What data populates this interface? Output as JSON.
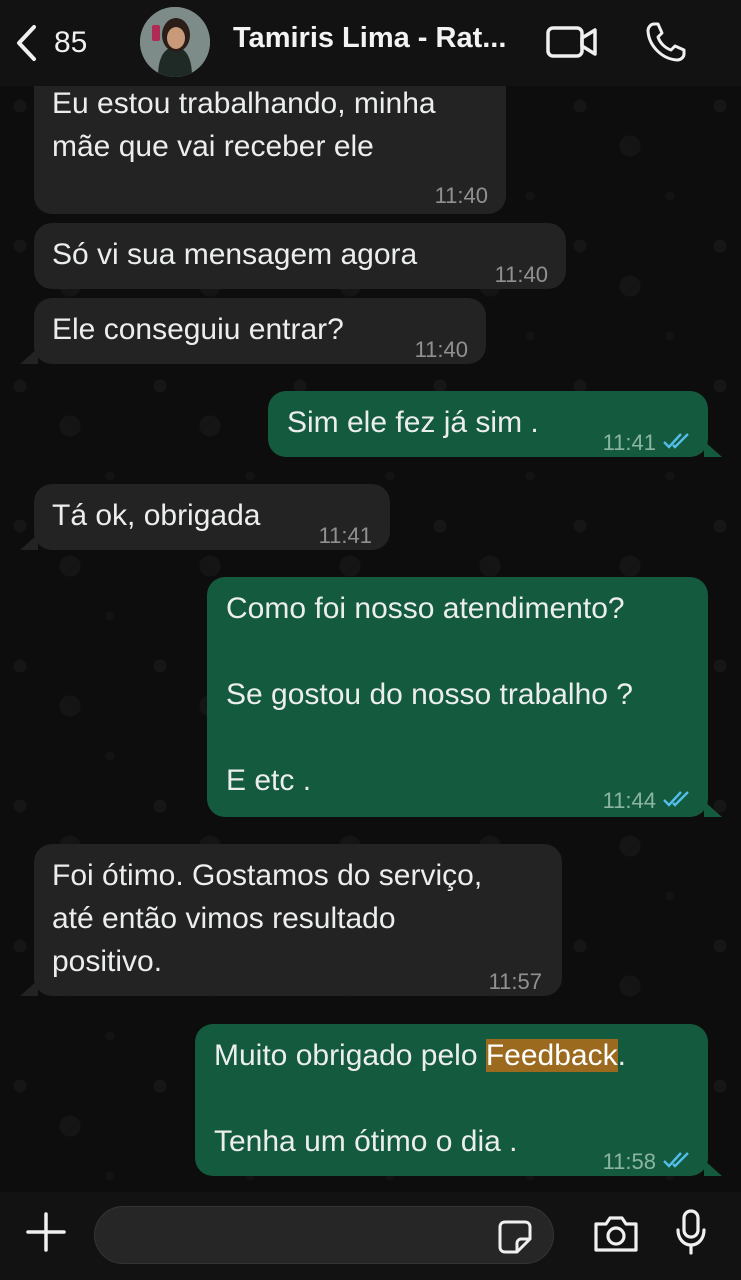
{
  "header": {
    "back_count": "85",
    "contact_name": "Tamiris Lima - Rat..."
  },
  "messages": [
    {
      "dir": "in",
      "text": "Eu estou trabalhando, minha\nmãe que vai receber ele",
      "time": "11:40"
    },
    {
      "dir": "in",
      "text": "Só vi sua mensagem agora",
      "time": "11:40"
    },
    {
      "dir": "in",
      "text": "Ele conseguiu entrar?",
      "time": "11:40"
    },
    {
      "dir": "out",
      "text": "Sim ele fez já sim .",
      "time": "11:41",
      "status": "read"
    },
    {
      "dir": "in",
      "text": "Tá ok, obrigada",
      "time": "11:41"
    },
    {
      "dir": "out",
      "text": "Como foi nosso atendimento?\n\nSe gostou do nosso trabalho ?\n\nE etc .",
      "time": "11:44",
      "status": "read"
    },
    {
      "dir": "in",
      "text": "Foi ótimo. Gostamos do serviço,\naté então vimos resultado\npositivo.",
      "time": "11:57"
    },
    {
      "dir": "out",
      "text_before": "Muito obrigado pelo ",
      "highlight": "Feedback",
      "text_after": ".\n\nTenha um ótimo o dia .",
      "time": "11:58",
      "status": "read"
    }
  ],
  "colors": {
    "incoming_bubble": "#232323",
    "outgoing_bubble": "#135a3e",
    "read_ticks": "#53bdeb",
    "highlight": "#9b6a1f"
  },
  "icons": [
    "chevron-left-icon",
    "video-call-icon",
    "phone-icon",
    "plus-icon",
    "sticker-icon",
    "camera-icon",
    "microphone-icon",
    "double-check-icon"
  ]
}
